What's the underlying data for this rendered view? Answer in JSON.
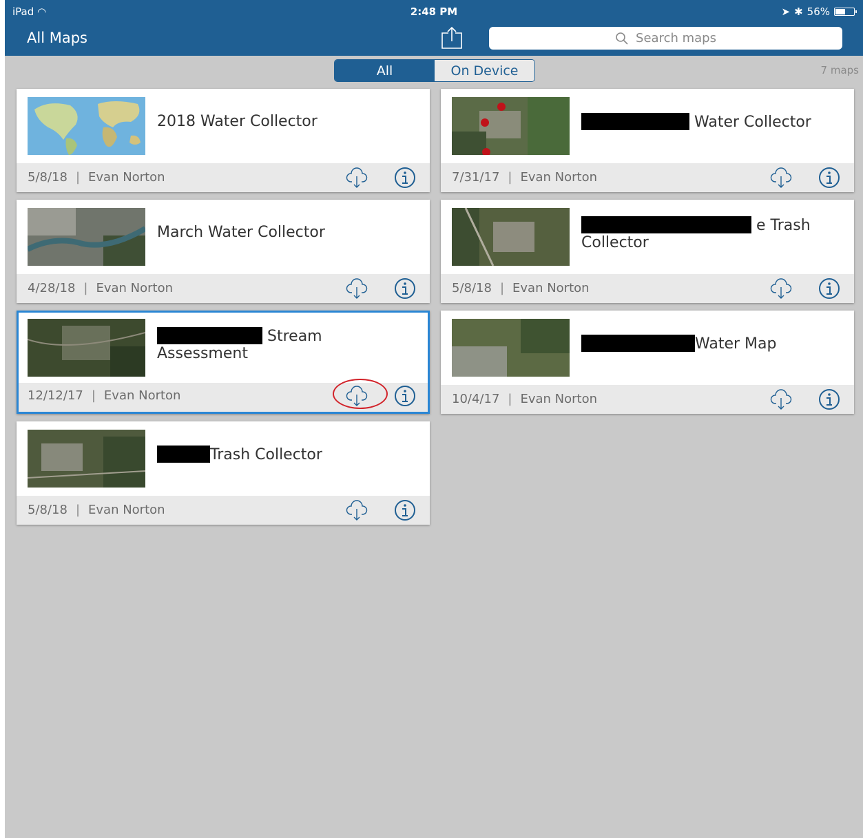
{
  "status": {
    "device": "iPad",
    "time": "2:48 PM",
    "battery": "56%",
    "battery_level": 0.56
  },
  "header": {
    "title": "All Maps"
  },
  "search": {
    "placeholder": "Search maps"
  },
  "filter": {
    "all": "All",
    "on_device": "On Device",
    "selected": "All"
  },
  "count": "7 maps",
  "colors": {
    "bar": "#1f5f93",
    "selected_border": "#2a86d4",
    "annotation": "#d2232a"
  },
  "maps": [
    {
      "name_before": "",
      "name_after": "2018 Water Collector",
      "date": "5/8/18",
      "owner": "Evan Norton",
      "thumbnail": "world-map"
    },
    {
      "name_before": "",
      "name_after": "Water Collector",
      "date": "7/31/17",
      "owner": "Evan Norton",
      "thumbnail": "satellite-points"
    },
    {
      "name_before": "",
      "name_after": "March Water Collector",
      "date": "4/28/18",
      "owner": "Evan Norton",
      "thumbnail": "satellite-river"
    },
    {
      "name_before": "",
      "name_after": "e Trash Collector",
      "date": "5/8/18",
      "owner": "Evan Norton",
      "thumbnail": "satellite"
    },
    {
      "name_before": "",
      "name_after": "Stream Assessment",
      "date": "12/12/17",
      "owner": "Evan Norton",
      "thumbnail": "satellite-forest",
      "selected": true
    },
    {
      "name_before": "",
      "name_after": "Water Map",
      "date": "10/4/17",
      "owner": "Evan Norton",
      "thumbnail": "satellite"
    },
    {
      "name_before": "",
      "name_after": "Trash Collector",
      "date": "5/8/18",
      "owner": "Evan Norton",
      "thumbnail": "satellite"
    }
  ],
  "icons": {
    "share": "share-icon",
    "search": "search-icon",
    "download": "cloud-download-icon",
    "info": "info-icon"
  }
}
